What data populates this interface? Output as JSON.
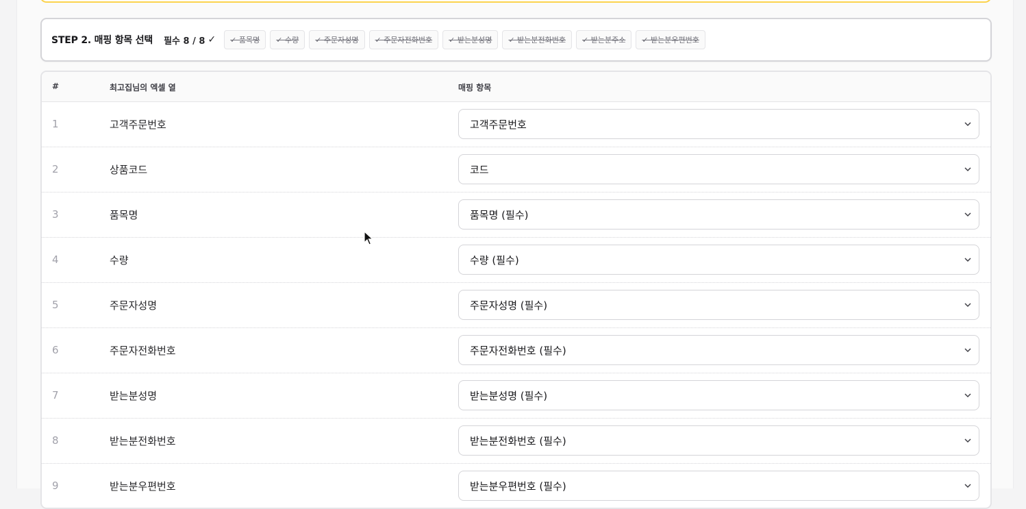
{
  "step": {
    "title": "STEP 2. 매핑 항목 선택",
    "required_label": "필수 8 / 8",
    "check": "✓",
    "chips": [
      "✓ 품목명",
      "✓ 수량",
      "✓ 주문자성명",
      "✓ 주문자전화번호",
      "✓ 받는분성명",
      "✓ 받는분전화번호",
      "✓ 받는분주소",
      "✓ 받는분우편번호"
    ]
  },
  "table": {
    "headers": {
      "num": "#",
      "column": "최고집님의 엑셀 열",
      "mapping": "매핑 항목"
    },
    "rows": [
      {
        "num": "1",
        "column": "고객주문번호",
        "mapping": "고객주문번호"
      },
      {
        "num": "2",
        "column": "상품코드",
        "mapping": "코드"
      },
      {
        "num": "3",
        "column": "품목명",
        "mapping": "품목명 (필수)"
      },
      {
        "num": "4",
        "column": "수량",
        "mapping": "수량 (필수)"
      },
      {
        "num": "5",
        "column": "주문자성명",
        "mapping": "주문자성명 (필수)"
      },
      {
        "num": "6",
        "column": "주문자전화번호",
        "mapping": "주문자전화번호 (필수)"
      },
      {
        "num": "7",
        "column": "받는분성명",
        "mapping": "받는분성명 (필수)"
      },
      {
        "num": "8",
        "column": "받는분전화번호",
        "mapping": "받는분전화번호 (필수)"
      },
      {
        "num": "9",
        "column": "받는분우편번호",
        "mapping": "받는분우편번호 (필수)"
      }
    ]
  },
  "icons": {
    "chevron": "chevron-down-icon",
    "cursor": "mouse-cursor-icon"
  }
}
